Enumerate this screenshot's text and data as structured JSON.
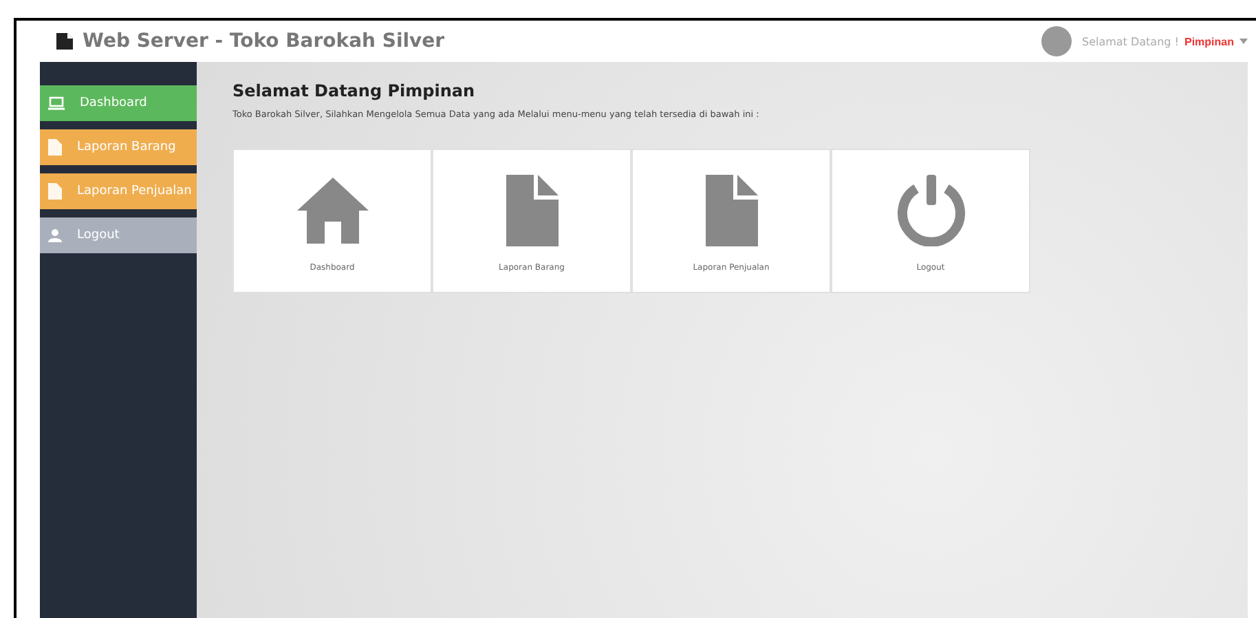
{
  "header": {
    "title": "Web Server - Toko Barokah Silver",
    "greeting": "Selamat Datang !",
    "user": "Pimpinan"
  },
  "sidebar": {
    "items": [
      {
        "label": "Dashboard",
        "kind": "monitor",
        "color": "#5cb85c"
      },
      {
        "label": "Laporan Barang",
        "kind": "file",
        "color": "#f0ad4e"
      },
      {
        "label": "Laporan Penjualan",
        "kind": "file",
        "color": "#f0ad4e"
      },
      {
        "label": "Logout",
        "kind": "user",
        "color": "#a9b0bb"
      }
    ]
  },
  "main": {
    "heading": "Selamat Datang Pimpinan",
    "subtitle": "Toko Barokah Silver, Silahkan Mengelola Semua Data yang ada Melalui menu-menu yang telah tersedia di bawah ini :",
    "tiles": [
      {
        "label": "Dashboard",
        "kind": "home"
      },
      {
        "label": "Laporan Barang",
        "kind": "file"
      },
      {
        "label": "Laporan Penjualan",
        "kind": "file"
      },
      {
        "label": "Logout",
        "kind": "power"
      }
    ]
  }
}
